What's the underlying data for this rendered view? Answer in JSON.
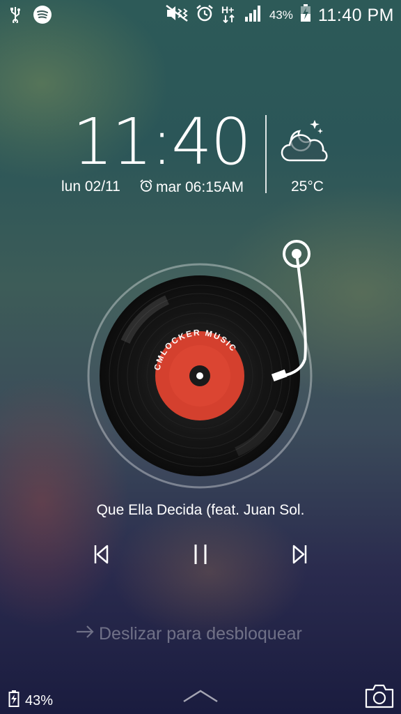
{
  "status_bar": {
    "icons_left": [
      "usb-icon",
      "spotify-icon"
    ],
    "icons_right": [
      "mute-vibrate-icon",
      "alarm-icon",
      "hplus-data-icon",
      "signal-icon"
    ],
    "battery_percent": "43%",
    "time": "11:40 PM"
  },
  "lockscreen": {
    "clock": "11:40",
    "date": "lun 02/11",
    "alarm": "mar 06:15AM",
    "weather_icon": "cloud-moon-icon",
    "temperature": "25°C"
  },
  "player": {
    "label_text": "CMLOCKER MUSIC",
    "track_title": "Que Ella Decida (feat. Juan Sol.",
    "controls": [
      "previous-icon",
      "pause-icon",
      "next-icon"
    ]
  },
  "footer": {
    "unlock_text": "Deslizar para desbloquear",
    "battery": "43%",
    "camera_icon": "camera-icon"
  },
  "colors": {
    "label_red": "#d4402e",
    "vinyl_black": "#141414"
  }
}
